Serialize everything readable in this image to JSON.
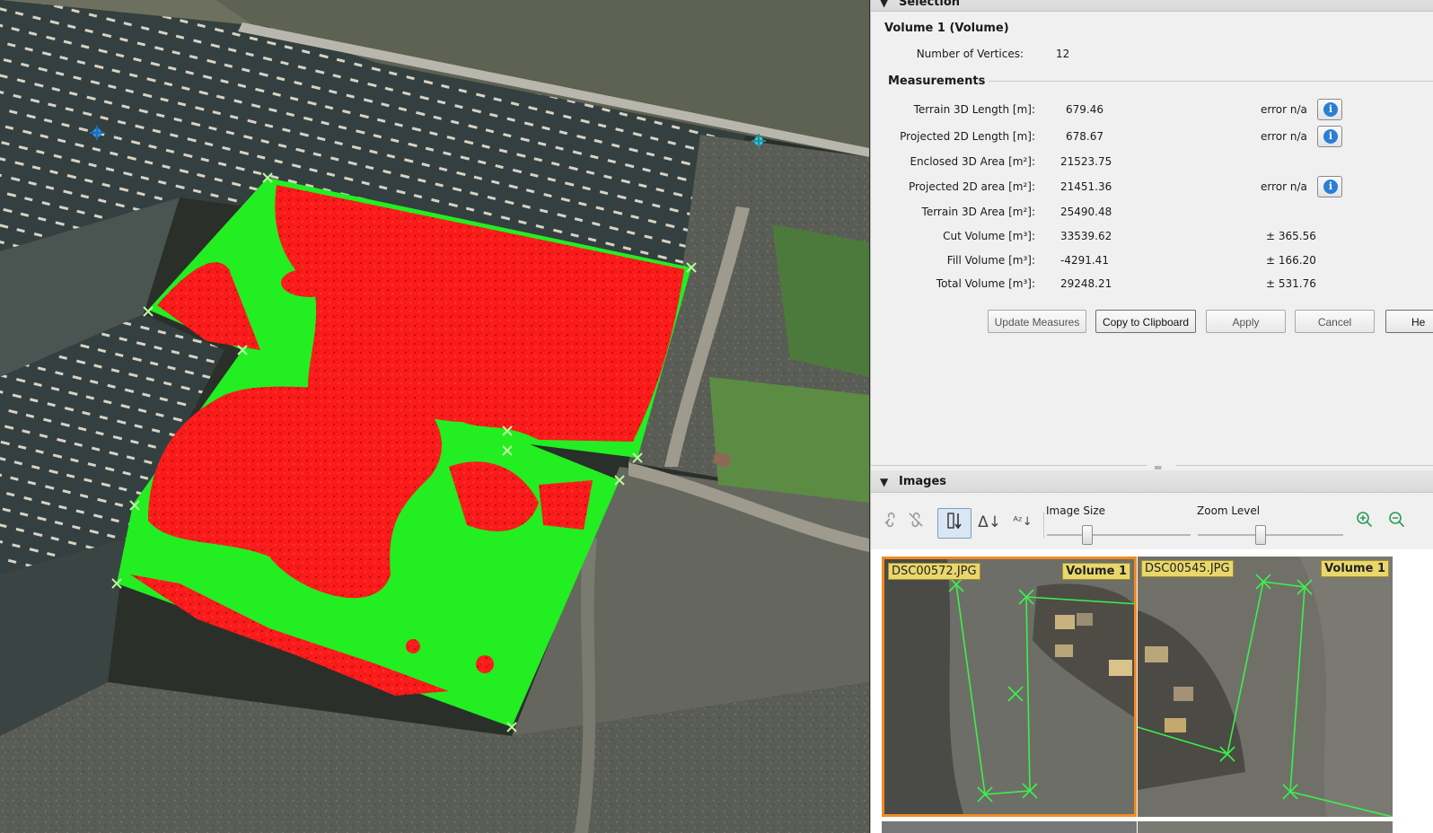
{
  "selection": {
    "section_title": "Selection",
    "object_title": "Volume 1 (Volume)",
    "vertices_label": "Number of Vertices:",
    "vertices_value": "12",
    "measurements_title": "Measurements",
    "rows": [
      {
        "label": "Terrain 3D Length [m]:",
        "value": "679.46",
        "extra": "error n/a",
        "info": true
      },
      {
        "label": "Projected 2D Length [m]:",
        "value": "678.67",
        "extra": "error n/a",
        "info": true
      },
      {
        "label": "Enclosed 3D Area [m²]:",
        "value": "21523.75",
        "extra": "",
        "info": false
      },
      {
        "label": "Projected 2D area [m²]:",
        "value": "21451.36",
        "extra": "error n/a",
        "info": true
      },
      {
        "label": "Terrain 3D Area [m²]:",
        "value": "25490.48",
        "extra": "",
        "info": false
      },
      {
        "label": "Cut Volume [m³]:",
        "value": "33539.62",
        "extra": "± 365.56",
        "info": false
      },
      {
        "label": "Fill Volume [m³]:",
        "value": "-4291.41",
        "extra": "± 166.20",
        "info": false
      },
      {
        "label": "Total Volume [m³]:",
        "value": "29248.21",
        "extra": "± 531.76",
        "info": false
      }
    ],
    "info_icon": "i",
    "buttons": {
      "update": "Update Measures",
      "copy": "Copy to Clipboard",
      "apply": "Apply",
      "cancel": "Cancel",
      "help": "He"
    }
  },
  "images": {
    "section_title": "Images",
    "image_size_label": "Image Size",
    "zoom_level_label": "Zoom Level",
    "image_size_level": 0.28,
    "zoom_level": 0.43,
    "icons": [
      "link-icon",
      "unlink-icon",
      "sort-order-icon",
      "sort-delta-icon",
      "sort-alpha-icon",
      "zoom-in-icon",
      "zoom-out-icon"
    ],
    "sort_delta_glyph": "Δ↓",
    "sort_alpha_glyph": "ᴬᶻ↓",
    "thumbnails": [
      {
        "name": "DSC00572.JPG",
        "volume": "Volume 1",
        "selected": true
      },
      {
        "name": "DSC00545.JPG",
        "volume": "Volume 1",
        "selected": false
      }
    ]
  },
  "colors": {
    "cut": "#ff1a1a",
    "fill": "#22ee22",
    "selected_border": "#f28a24",
    "info_blue": "#2a7fd4"
  }
}
